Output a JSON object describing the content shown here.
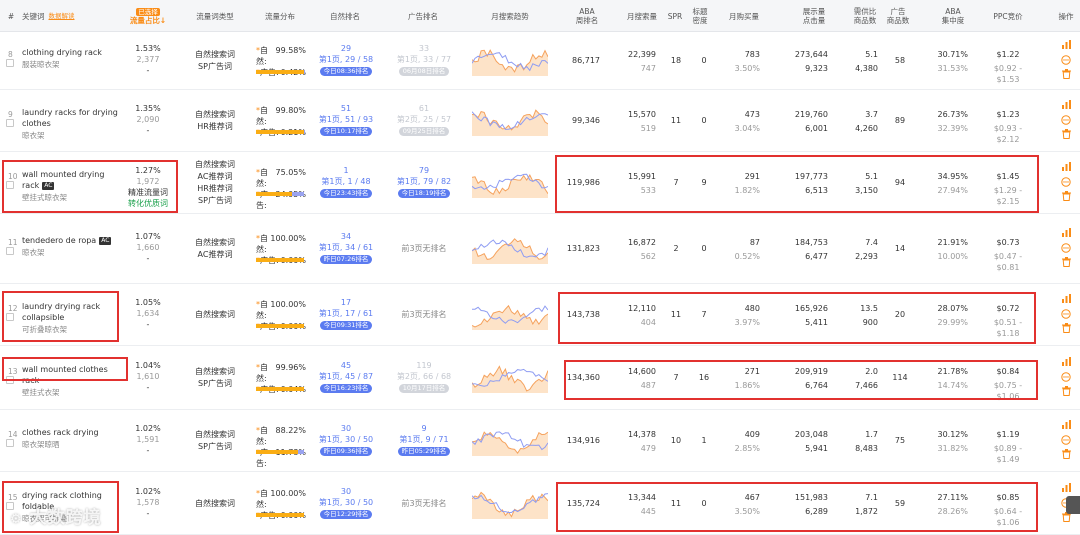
{
  "header": {
    "index": "#",
    "keyword": "关键词",
    "keyword_link": "数据解读",
    "flow_share_badge": "已选择",
    "flow_share": "流量占比↓",
    "kw_type": "流量词类型",
    "flow_dist": "流量分布",
    "natural_rank": "自然排名",
    "ad_rank": "广告排名",
    "trend": "月搜索趋势",
    "aba": "ABA\n周排名",
    "monthly_search": "月搜索量",
    "spr": "SPR",
    "title_density": "标题\n密度",
    "monthly_buy": "月购买量",
    "impr_click": "展示量\n点击量",
    "supply_demand": "需供比\n商品数",
    "ad_products": "广告\n商品数",
    "aba_conc": "ABA\n集中度",
    "ppc": "PPC竞价",
    "ops": "操作"
  },
  "rows": [
    {
      "idx": "8",
      "kw": "clothing drying rack",
      "cn": "服装晾衣架",
      "share": "1.53%",
      "share_n": "2,377",
      "share_dash": "-",
      "types": [
        "自然搜索词",
        "SP广告词"
      ],
      "nat_label": "自然:",
      "nat": "99.58%",
      "ad_label": "广告:",
      "ad": "0.42%",
      "ad_frac": 0.0042,
      "nrank": "29",
      "npos": "第1页, 29 / 58",
      "npill": "今日08:36排名",
      "arank": "33",
      "apos": "第1页, 33 / 77",
      "apill": "06月08日排名",
      "aba": "86,717",
      "ms": "22,399",
      "ms2": "747",
      "spr": "18",
      "td": "0",
      "buy": "783",
      "buy2": "3.50%",
      "impr": "273,644",
      "click": "9,323",
      "sd": "5.1",
      "sd2": "4,380",
      "adp": "58",
      "conc": "30.71%",
      "conc2": "31.53%",
      "ppc": "$1.22",
      "ppc2": "$0.92 - $1.53"
    },
    {
      "idx": "9",
      "kw": "laundry racks for drying clothes",
      "cn": "晾衣架",
      "share": "1.35%",
      "share_n": "2,090",
      "share_dash": "-",
      "types": [
        "自然搜索词",
        "HR推荐词"
      ],
      "nat_label": "自然:",
      "nat": "99.80%",
      "ad_label": "广告:",
      "ad": "0.21%",
      "ad_frac": 0.0021,
      "nrank": "51",
      "npos": "第1页, 51 / 93",
      "npill": "今日10:17排名",
      "arank": "61",
      "apos": "第2页, 25 / 57",
      "apill": "09月25日排名",
      "aba": "99,346",
      "ms": "15,570",
      "ms2": "519",
      "spr": "11",
      "td": "0",
      "buy": "473",
      "buy2": "3.04%",
      "impr": "219,760",
      "click": "6,001",
      "sd": "3.7",
      "sd2": "4,260",
      "adp": "89",
      "conc": "26.73%",
      "conc2": "32.39%",
      "ppc": "$1.23",
      "ppc2": "$0.93 - $2.12"
    },
    {
      "idx": "10",
      "kw": "wall mounted drying rack",
      "ac": "AC",
      "cn": "壁挂式晾衣架",
      "share": "1.27%",
      "share_n": "1,972",
      "share_tag1": "精准流量词",
      "share_tag2": "转化优质词",
      "types": [
        "自然搜索词",
        "AC推荐词",
        "HR推荐词",
        "SP广告词"
      ],
      "nat_label": "自然:",
      "nat": "75.05%",
      "ad_label": "广告:",
      "ad": "24.95%",
      "ad_frac": 0.2495,
      "nrank": "1",
      "npos": "第1页, 1 / 48",
      "npill": "今日23:43排名",
      "arank": "79",
      "apos": "第1页, 79 / 82",
      "apill": "今日18:19排名",
      "aba": "119,986",
      "ms": "15,991",
      "ms2": "533",
      "spr": "7",
      "td": "9",
      "buy": "291",
      "buy2": "1.82%",
      "impr": "197,773",
      "click": "6,513",
      "sd": "5.1",
      "sd2": "3,150",
      "adp": "94",
      "conc": "34.95%",
      "conc2": "27.94%",
      "ppc": "$1.45",
      "ppc2": "$1.29 - $2.15"
    },
    {
      "idx": "11",
      "kw": "tendedero de ropa",
      "ac": "AC",
      "cn": "晾衣架",
      "share": "1.07%",
      "share_n": "1,660",
      "share_dash": "-",
      "types": [
        "自然搜索词",
        "AC推荐词"
      ],
      "nat_label": "自然:",
      "nat": "100.00%",
      "ad_label": "广告:",
      "ad": "0.00%",
      "ad_frac": 0,
      "nrank": "34",
      "npos": "第1页, 34 / 61",
      "npill": "昨日07:26排名",
      "arank_text": "前3页无排名",
      "aba": "131,823",
      "ms": "16,872",
      "ms2": "562",
      "spr": "2",
      "td": "0",
      "buy": "87",
      "buy2": "0.52%",
      "impr": "184,753",
      "click": "6,477",
      "sd": "7.4",
      "sd2": "2,293",
      "adp": "14",
      "conc": "21.91%",
      "conc2": "10.00%",
      "ppc": "$0.73",
      "ppc2": "$0.47 - $0.81"
    },
    {
      "idx": "12",
      "kw": "laundry drying rack collapsible",
      "cn": "可折叠晾衣架",
      "share": "1.05%",
      "share_n": "1,634",
      "share_dash": "-",
      "types": [
        "自然搜索词"
      ],
      "nat_label": "自然:",
      "nat": "100.00%",
      "ad_label": "广告:",
      "ad": "0.00%",
      "ad_frac": 0,
      "nrank": "17",
      "npos": "第1页, 17 / 61",
      "npill": "今日09:31排名",
      "arank_text": "前3页无排名",
      "aba": "143,738",
      "ms": "12,110",
      "ms2": "404",
      "spr": "11",
      "td": "7",
      "buy": "480",
      "buy2": "3.97%",
      "impr": "165,926",
      "click": "5,411",
      "sd": "13.5",
      "sd2": "900",
      "adp": "20",
      "conc": "28.07%",
      "conc2": "29.99%",
      "ppc": "$0.72",
      "ppc2": "$0.51 - $1.18"
    },
    {
      "idx": "13",
      "kw": "wall mounted clothes rack",
      "cn": "壁挂式衣架",
      "share": "1.04%",
      "share_n": "1,610",
      "share_dash": "-",
      "types": [
        "自然搜索词",
        "SP广告词"
      ],
      "nat_label": "自然:",
      "nat": "99.96%",
      "ad_label": "广告:",
      "ad": "0.04%",
      "ad_frac": 0.0004,
      "nrank": "45",
      "npos": "第1页, 45 / 87",
      "npill": "今日16:23排名",
      "arank": "119",
      "apos": "第2页, 66 / 68",
      "apill": "10月17日排名",
      "aba": "134,360",
      "ms": "14,600",
      "ms2": "487",
      "spr": "7",
      "td": "16",
      "buy": "271",
      "buy2": "1.86%",
      "impr": "209,919",
      "click": "6,764",
      "sd": "2.0",
      "sd2": "7,466",
      "adp": "114",
      "conc": "21.78%",
      "conc2": "14.74%",
      "ppc": "$0.84",
      "ppc2": "$0.75 - $1.06"
    },
    {
      "idx": "14",
      "kw": "clothes rack drying",
      "cn": "晾衣架晾晒",
      "share": "1.02%",
      "share_n": "1,591",
      "share_dash": "-",
      "types": [
        "自然搜索词",
        "SP广告词"
      ],
      "nat_label": "自然:",
      "nat": "88.22%",
      "ad_label": "广告:",
      "ad": "11.78%",
      "ad_frac": 0.1178,
      "nrank": "30",
      "npos": "第1页, 30 / 50",
      "npill": "昨日09:36排名",
      "arank": "9",
      "apos": "第1页, 9 / 71",
      "apill": "昨日05:29排名",
      "aba": "134,916",
      "ms": "14,378",
      "ms2": "479",
      "spr": "10",
      "td": "1",
      "buy": "409",
      "buy2": "2.85%",
      "impr": "203,048",
      "click": "5,941",
      "sd": "1.7",
      "sd2": "8,483",
      "adp": "75",
      "conc": "30.12%",
      "conc2": "31.82%",
      "ppc": "$1.19",
      "ppc2": "$0.89 - $1.49"
    },
    {
      "idx": "15",
      "kw": "drying rack clothing foldable",
      "cn": "晾衣架可折叠",
      "share": "1.02%",
      "share_n": "1,578",
      "share_dash": "-",
      "types": [
        "自然搜索词"
      ],
      "nat_label": "自然:",
      "nat": "100.00%",
      "ad_label": "广告:",
      "ad": "0.00%",
      "ad_frac": 0,
      "nrank": "30",
      "npos": "第1页, 30 / 50",
      "npill": "今日12:29排名",
      "arank_text": "前3页无排名",
      "aba": "135,724",
      "ms": "13,344",
      "ms2": "445",
      "spr": "11",
      "td": "0",
      "buy": "467",
      "buy2": "3.50%",
      "impr": "151,983",
      "click": "6,289",
      "sd": "7.1",
      "sd2": "1,872",
      "adp": "59",
      "conc": "27.11%",
      "conc2": "28.26%",
      "ppc": "$0.85",
      "ppc2": "$0.64 - $1.06"
    }
  ],
  "watermark": "大数跨境",
  "colors": {
    "accent": "#fa8c16",
    "rank_blue": "#5b7bf0",
    "red_box": "#e2312f",
    "ad_bar": "#9aa3f0",
    "natural_bar": "#faad14"
  }
}
